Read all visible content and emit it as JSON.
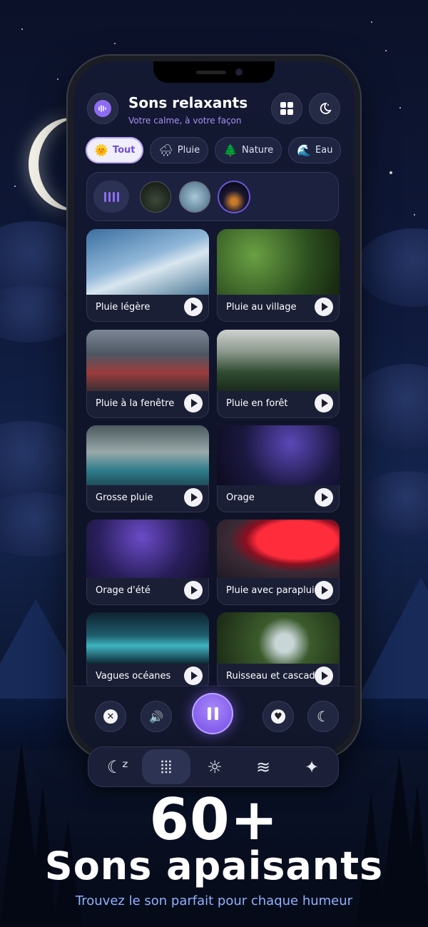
{
  "app": {
    "title": "Sons relaxants",
    "subtitle": "Votre calme, à votre façon"
  },
  "header": {
    "app_icon": "sound-wave-icon",
    "grid_icon": "grid-icon",
    "night_icon": "moon-stars-icon"
  },
  "categories": [
    {
      "label": "Tout",
      "icon": "sun-icon",
      "glyph": "🌞",
      "active": true
    },
    {
      "label": "Pluie",
      "icon": "rain-cloud-icon",
      "glyph": "🌧"
    },
    {
      "label": "Nature",
      "icon": "tree-icon",
      "glyph": "🌲"
    },
    {
      "label": "Eau",
      "icon": "wave-icon",
      "glyph": "🌊"
    }
  ],
  "mixer": {
    "icon": "equalizer-icon",
    "active_sounds": [
      "forest-thumb",
      "water-thumb",
      "campfire-thumb"
    ]
  },
  "sounds": [
    {
      "label": "Pluie légère"
    },
    {
      "label": "Pluie au village"
    },
    {
      "label": "Pluie à la fenêtre"
    },
    {
      "label": "Pluie en forêt"
    },
    {
      "label": "Grosse pluie"
    },
    {
      "label": "Orage"
    },
    {
      "label": "Orage d'été"
    },
    {
      "label": "Pluie avec parapluie"
    },
    {
      "label": "Vagues océanes"
    },
    {
      "label": "Ruisseau et cascade"
    }
  ],
  "player": {
    "stop_glyph": "✕",
    "volume_glyph": "🔊",
    "favorite_glyph": "♥",
    "timer_glyph": "☾"
  },
  "tabbar": [
    {
      "name": "sleep",
      "glyph": "☾ᶻ"
    },
    {
      "name": "sounds",
      "glyph": "⦙⦙⦙",
      "active": true
    },
    {
      "name": "light",
      "glyph": "☼"
    },
    {
      "name": "breathe",
      "glyph": "≋"
    },
    {
      "name": "magic",
      "glyph": "✦"
    }
  ],
  "hero": {
    "count": "60+",
    "title": "Sons apaisants",
    "subtitle": "Trouvez le son parfait pour chaque humeur"
  },
  "colors": {
    "accent": "#8d6cf2",
    "subtitle": "#a88ef5",
    "hero_sub": "#8fb2ff"
  }
}
